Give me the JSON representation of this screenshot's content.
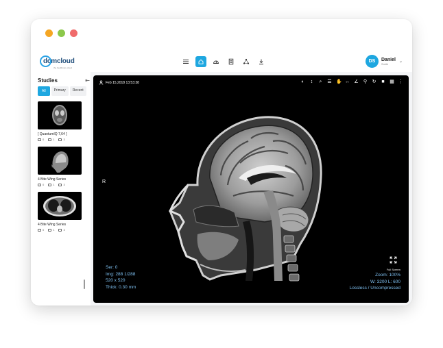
{
  "window": {
    "controls": [
      "close",
      "minimize",
      "maximize"
    ]
  },
  "header": {
    "logo": {
      "text": "dcmcloud",
      "tagline": "the healthcare cloud"
    },
    "nav": [
      {
        "icon": "menu-icon",
        "active": false
      },
      {
        "icon": "home-icon",
        "active": true
      },
      {
        "icon": "dashboard-icon",
        "active": false
      },
      {
        "icon": "document-icon",
        "active": false
      },
      {
        "icon": "share-icon",
        "active": false
      },
      {
        "icon": "download-icon",
        "active": false
      }
    ],
    "user": {
      "initials": "DS",
      "first_name": "Daniel",
      "last_name": "Smith"
    }
  },
  "sidebar": {
    "title": "Studies",
    "tabs": [
      {
        "label": "All",
        "active": true
      },
      {
        "label": "Primary",
        "active": false
      },
      {
        "label": "Recent",
        "active": false
      }
    ],
    "studies": [
      {
        "name": "[ QuantumIQ 7,64 ]",
        "series": "0",
        "images": "1",
        "files": "3"
      },
      {
        "name": "4 Bite Wing Series",
        "series": "0",
        "images": "1",
        "files": "3"
      },
      {
        "name": "4 Bite Wing Series",
        "series": "0",
        "images": "1",
        "files": "3"
      }
    ]
  },
  "viewer": {
    "date": "Feb 15,2018 13:53:38",
    "orientation": "R",
    "fullscreen_label": "Full Screen",
    "info_left": {
      "series": "Ser: 0",
      "image": "Img: 288 1/288",
      "size": "520 x 520",
      "thickness": "Thick: 0.30 mm"
    },
    "info_right": {
      "zoom": "Zoom: 100%",
      "window": "W: 3200 L: 600",
      "compression": "Lossless / Uncompressed"
    },
    "tools": [
      "contrast-icon",
      "stack-scroll-icon",
      "zoom-icon",
      "levels-icon",
      "pan-icon",
      "length-icon",
      "angle-icon",
      "probe-icon",
      "rotate-icon",
      "cine-icon",
      "layout-icon",
      "more-icon"
    ]
  },
  "colors": {
    "accent": "#1ea7e0",
    "overlay_text": "#7fc1f2"
  }
}
